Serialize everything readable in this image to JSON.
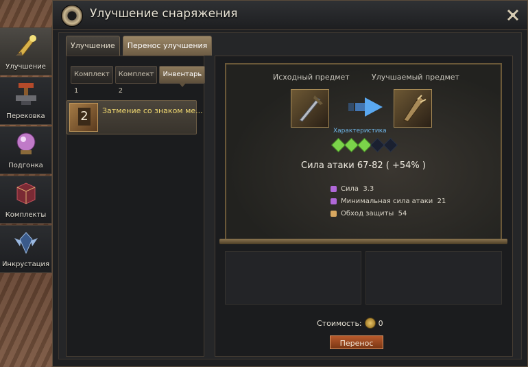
{
  "window": {
    "title": "Улучшение снаряжения"
  },
  "side_nav": {
    "items": [
      {
        "label": "Улучшение",
        "icon": "upgrade-brush-icon",
        "active": true
      },
      {
        "label": "Перековка",
        "icon": "anvil-hammer-icon",
        "active": false
      },
      {
        "label": "Подгонка",
        "icon": "crystal-ball-icon",
        "active": false
      },
      {
        "label": "Комплекты",
        "icon": "set-cube-icon",
        "active": false
      },
      {
        "label": "Инкрустация",
        "icon": "crest-emblem-icon",
        "active": false
      }
    ]
  },
  "tabs": [
    {
      "label": "Улучшение",
      "active": false
    },
    {
      "label": "Перенос улучшения",
      "active": true
    }
  ],
  "subtabs": [
    {
      "label": "Комплект 1",
      "active": false
    },
    {
      "label": "Комплект 2",
      "active": false
    },
    {
      "label": "Инвентарь",
      "active": true
    }
  ],
  "inventory": {
    "items": [
      {
        "count": "2",
        "name": "Затмение со знаком ме..."
      }
    ]
  },
  "transfer": {
    "source_label": "Исходный предмет",
    "target_label": "Улучшаемый предмет",
    "characteristic_label": "Характеристика",
    "gems": {
      "filled": 3,
      "total": 5
    },
    "attack": "Сила атаки 67-82 ( +54% )",
    "stats": [
      {
        "label": "Сила",
        "value": "3.3",
        "color": "#b068d8"
      },
      {
        "label": "Минимальная сила атаки",
        "value": "21",
        "color": "#b068d8"
      },
      {
        "label": "Обход защиты",
        "value": "54",
        "color": "#d8a860"
      }
    ]
  },
  "cost": {
    "label": "Стоимость:",
    "value": "0"
  },
  "buttons": {
    "transfer": "Перенос"
  }
}
